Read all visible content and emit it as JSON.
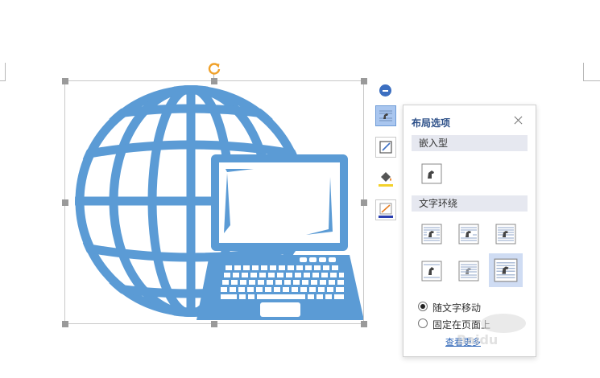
{
  "panel": {
    "title": "布局选项",
    "section_inline": "嵌入型",
    "section_wrap": "文字环绕",
    "radio_move": "随文字移动",
    "radio_fixed": "固定在页面上",
    "more_link": "查看更多"
  },
  "icons": {
    "rotate": "rotate-handle-icon",
    "collapse": "minus-circle-icon",
    "layout": "layout-options-icon",
    "crop": "crop-icon",
    "fill": "fill-bucket-icon",
    "outline": "outline-pen-icon",
    "close": "close-icon"
  },
  "colors": {
    "picture": "#5b9bd5",
    "accent": "#3c6fc1",
    "rotate": "#f0a12a",
    "selected_bg": "#cfdcf3"
  },
  "state": {
    "selected_wrap_option": "wrap-behind-text",
    "anchor_mode": "随文字移动"
  }
}
